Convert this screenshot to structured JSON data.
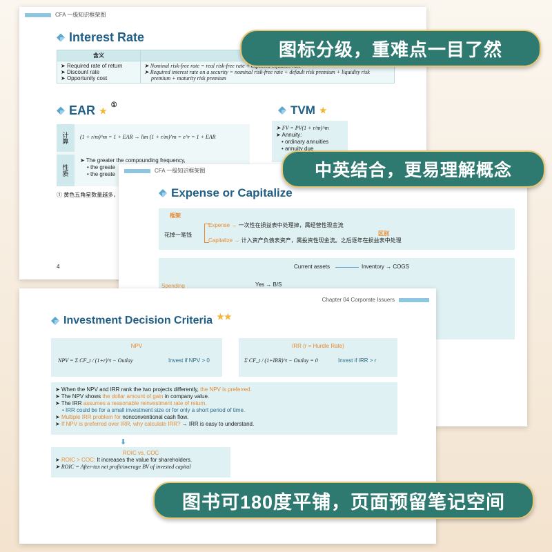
{
  "page1": {
    "header": "CFA 一级知识框架图",
    "interest_rate": {
      "title": "Interest Rate",
      "col_header": "含义",
      "left_items": [
        "Required rate of return",
        "Discount rate",
        "Opportunity cost"
      ],
      "right_items": [
        "Nominal risk-free rate = real risk-free rate + expected inflation rate",
        "Required interest rate on a security = nominal risk-free rate + default risk premium + liquidity risk",
        "premium + maturity risk premium"
      ]
    },
    "ear": {
      "title": "EAR",
      "marker": "①",
      "row1_label": "计算",
      "formula": "(1 + r/m)^m = 1 + EAR → lim (1 + r/m)^m = e^r = 1 + EAR",
      "row2_label": "性质",
      "prop1": "The greater the compounding frequency,",
      "prop2": "• the greate",
      "prop3": "• the greate"
    },
    "tvm": {
      "title": "TVM",
      "formula": "FV = PV(1 + r/m)^m",
      "item1": "Annuity:",
      "item2": "• ordinary annuities",
      "item3": "• annuity due"
    },
    "footnote": "① 黄色五角星数量越多，代表",
    "page_number": "4"
  },
  "page2": {
    "header": "CFA 一级知识框架图",
    "title": "Expense or Capitalize",
    "framework_label": "框架",
    "spend_label": "花掉一笔钱",
    "expense_line_key": "Expense",
    "expense_line_rest": "一次性在损益表中处理掉，属经营性现金流",
    "capitalize_line_key": "Capitalize",
    "capitalize_line_rest": "计入资产负债表资产，属投资性现金流。之后逐年在损益表中处理",
    "diff_label": "区别",
    "current_assets": "Current assets",
    "inventory_cogs": "Inventory → COGS",
    "spending": "Spending",
    "yes_bs": "Yes → B/S"
  },
  "page3": {
    "header": "Chapter 04 Corporate Issuers",
    "title": "Investment Decision Criteria",
    "npv": {
      "label": "NPV",
      "formula": "NPV = Σ CF_t / (1+r)^t − Outlay",
      "rule": "Invest if NPV > 0"
    },
    "irr": {
      "label": "IRR (r = Hurdle Rate)",
      "formula": "Σ CF_t / (1+IRR)^t − Outlay = 0",
      "rule": "Invest if IRR > r"
    },
    "points": {
      "p1a": "When the NPV and IRR rank the two projects differently,",
      "p1b": "the NPV is preferred.",
      "p2a": "The NPV shows",
      "p2b": "the dollar amount of gain",
      "p2c": "in company value.",
      "p3a": "The IRR",
      "p3b": "assumes a reasonable reinvestment rate of return.",
      "p4": "• IRR could be for a small investment size or for only a short period of time.",
      "p5a": "Multiple IRR problem for",
      "p5b": "nonconventional cash flow.",
      "p6a": "If NPV is preferred over IRR,",
      "p6b": "why calculate IRR?",
      "p6c": "→ IRR is easy to understand."
    },
    "roic": {
      "label": "ROIC vs. COC",
      "line1a": "ROIC > COC:",
      "line1b": "It increases the value for shareholders.",
      "line2": "ROIC = After-tax net profit/average BV of invested capital"
    }
  },
  "banners": {
    "b1": "图标分级，重难点一目了然",
    "b2": "中英结合，更易理解概念",
    "b3": "图书可180度平铺，页面预留笔记空间"
  },
  "colors": {
    "accent": "#2f7a70",
    "title_blue": "#1f5f86",
    "highlight": "#e9892f",
    "box": "#dff1f3"
  }
}
